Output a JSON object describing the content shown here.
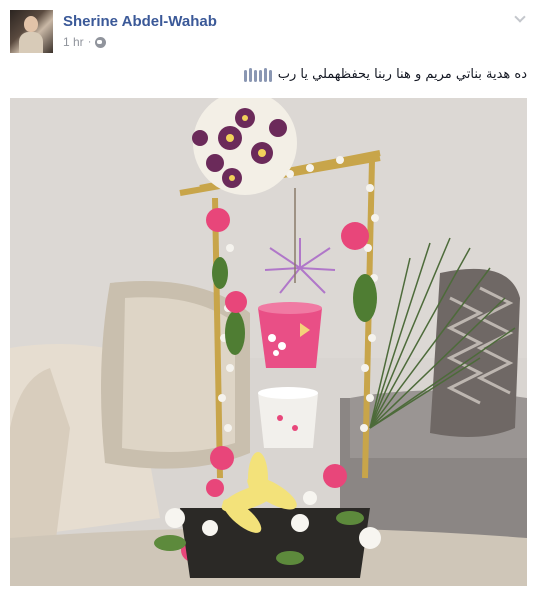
{
  "post": {
    "author_name": "Sherine Abdel-Wahab",
    "timestamp": "1 hr",
    "separator": "·",
    "audience_icon": "globe-icon",
    "menu_icon": "chevron-down-icon",
    "text": "ده هدية بناتي مريم و هنا ربنا يحفظهملي يا رب",
    "emoji_icon": "raised-hands-icon"
  },
  "photo": {
    "description_icon": "flower-arrangement-photo"
  },
  "colors": {
    "author": "#3b5998",
    "meta": "#90949c",
    "wall": "#d8d4d0",
    "sofa": "#cfc6ba",
    "flower_pink": "#e8467a",
    "flower_purple": "#6b2a5a",
    "lily_yellow": "#f3e27a",
    "bucket_pink": "#e94f86",
    "frame_gold": "#c8a54a"
  }
}
